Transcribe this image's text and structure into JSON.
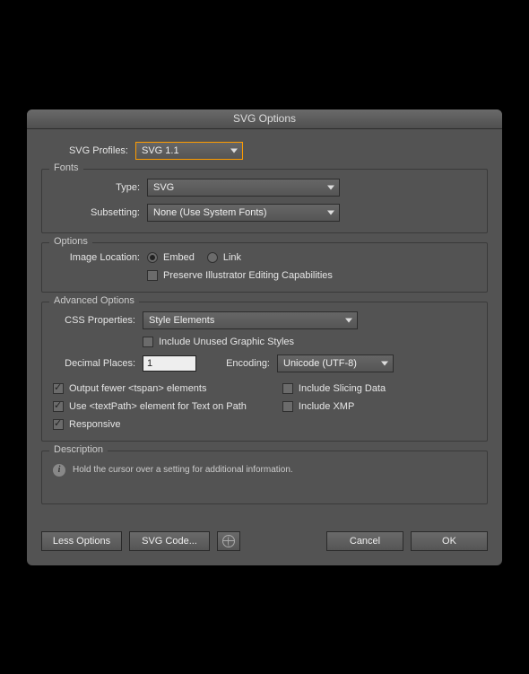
{
  "title": "SVG Options",
  "profiles": {
    "label": "SVG Profiles:",
    "value": "SVG 1.1"
  },
  "fonts": {
    "legend": "Fonts",
    "type": {
      "label": "Type:",
      "value": "SVG"
    },
    "subsetting": {
      "label": "Subsetting:",
      "value": "None (Use System Fonts)"
    }
  },
  "options": {
    "legend": "Options",
    "imageLocation": {
      "label": "Image Location:",
      "embed": "Embed",
      "link": "Link"
    },
    "preserve": "Preserve Illustrator Editing Capabilities"
  },
  "advanced": {
    "legend": "Advanced Options",
    "css": {
      "label": "CSS Properties:",
      "value": "Style Elements"
    },
    "includeUnused": "Include Unused Graphic Styles",
    "decimals": {
      "label": "Decimal Places:",
      "value": "1"
    },
    "encoding": {
      "label": "Encoding:",
      "value": "Unicode (UTF-8)"
    },
    "tspan": "Output fewer <tspan> elements",
    "slicing": "Include Slicing Data",
    "textpath": "Use <textPath> element for Text on Path",
    "xmp": "Include XMP",
    "responsive": "Responsive"
  },
  "description": {
    "legend": "Description",
    "text": "Hold the cursor over a setting for additional information."
  },
  "buttons": {
    "less": "Less Options",
    "svgcode": "SVG Code...",
    "cancel": "Cancel",
    "ok": "OK"
  }
}
